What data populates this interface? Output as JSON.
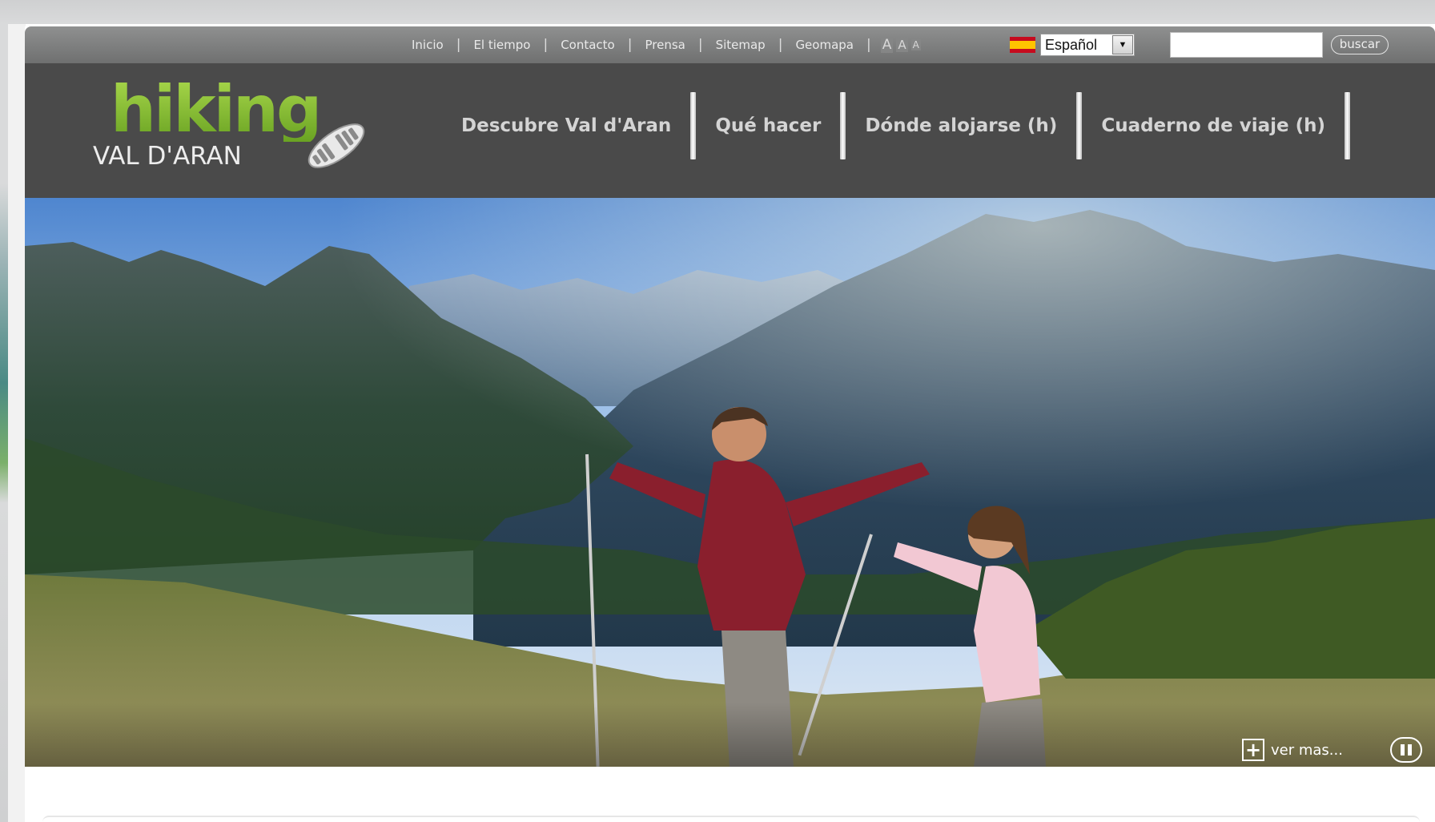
{
  "utility_nav": {
    "links": [
      "Inicio",
      "El tiempo",
      "Contacto",
      "Prensa",
      "Sitemap",
      "Geomapa"
    ],
    "font_size_controls": [
      "A",
      "A",
      "A"
    ]
  },
  "language": {
    "selected": "Español",
    "flag_icon": "spain-flag-icon"
  },
  "search": {
    "value": "",
    "button_label": "buscar"
  },
  "logo": {
    "title": "hiking",
    "subtitle": "VAL D'ARAN",
    "icon": "boot-sole-icon"
  },
  "main_nav": {
    "items": [
      "Descubre Val d'Aran",
      "Qué hacer",
      "Dónde alojarse (h)",
      "Cuaderno de viaje (h)"
    ]
  },
  "hero": {
    "more_label": "ver mas...",
    "more_icon": "plus-icon",
    "pause_icon": "pause-icon"
  },
  "colors": {
    "brand_green": "#8dc63f",
    "header_bg": "#4a4a4a",
    "utility_bar_bg": "#7a7b7b"
  }
}
